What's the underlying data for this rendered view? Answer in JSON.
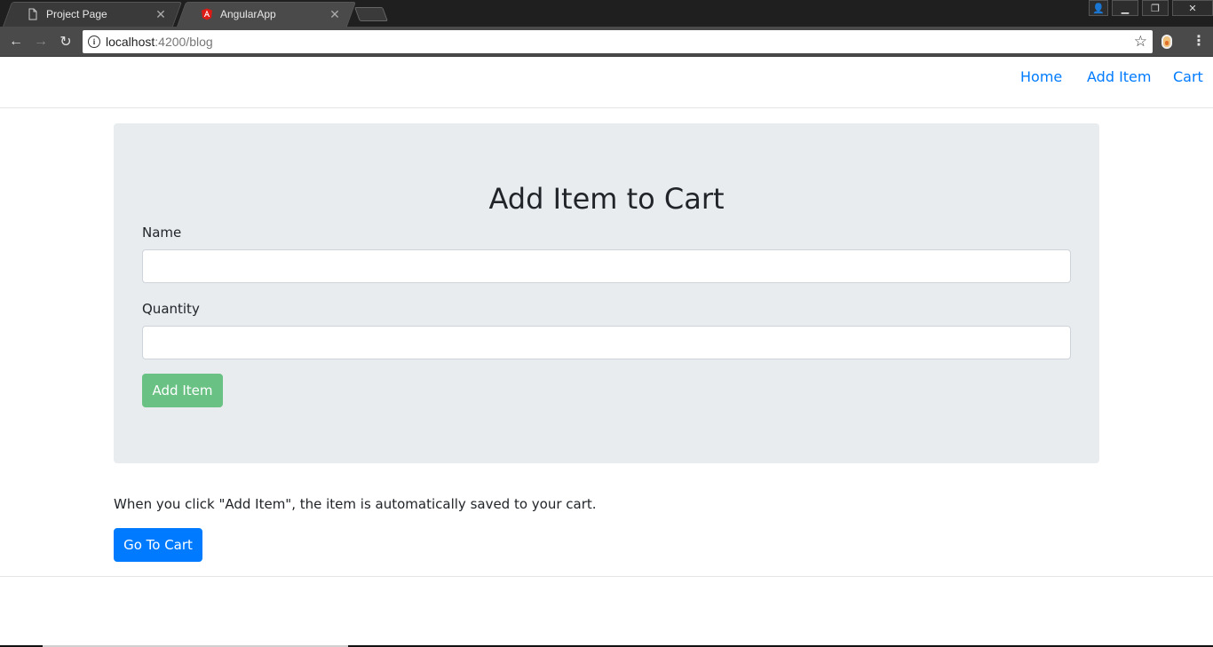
{
  "browser": {
    "tabs": [
      {
        "label": "Project Page",
        "icon": "document-icon",
        "active": false
      },
      {
        "label": "AngularApp",
        "icon": "angular-icon",
        "active": true
      }
    ],
    "close_glyph": "✕",
    "url": {
      "host": "localhost",
      "path": ":4200/blog"
    },
    "window_buttons": {
      "user": "👤",
      "minimize": "▁",
      "restore": "❐",
      "close": "✕"
    },
    "nav": {
      "back": "←",
      "forward": "→",
      "reload": "↻"
    },
    "star": "☆",
    "menu": "⋮",
    "info": "i"
  },
  "navbar": {
    "links": [
      {
        "label": "Home"
      },
      {
        "label": "Add Item"
      },
      {
        "label": "Cart"
      }
    ]
  },
  "form": {
    "title": "Add Item to Cart",
    "name_label": "Name",
    "name_value": "",
    "quantity_label": "Quantity",
    "quantity_value": "",
    "submit_label": "Add Item",
    "submit_color": "#6ac184"
  },
  "info_text": "When you click \"Add Item\", the item is automatically saved to your cart.",
  "cart_button_label": "Go To Cart",
  "colors": {
    "link": "#007bff",
    "primary": "#007bff",
    "jumbotron_bg": "#e9ecef"
  }
}
